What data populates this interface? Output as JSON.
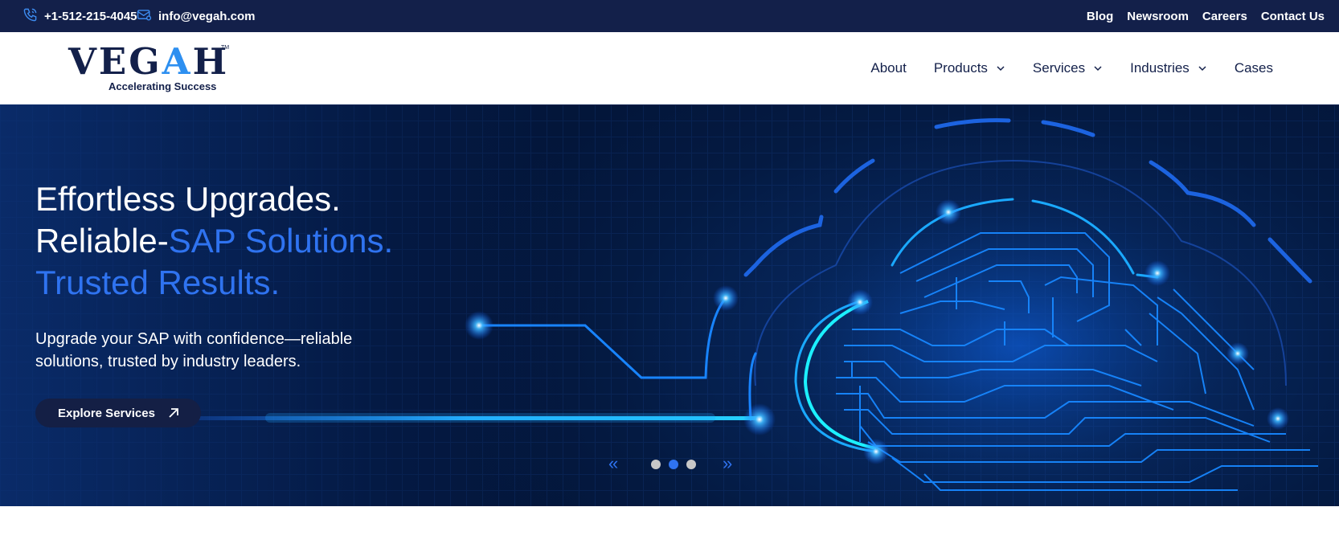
{
  "topbar": {
    "phone": "+1-512-215-4045",
    "email": "info@vegah.com",
    "links": [
      "Blog",
      "Newsroom",
      "Careers",
      "Contact Us"
    ],
    "background": "#13204a"
  },
  "logo": {
    "word_start": "VEG",
    "word_a": "A",
    "word_end": "H",
    "tagline": "Accelerating Success",
    "trademark": "TM"
  },
  "nav": {
    "items": [
      {
        "label": "About"
      },
      {
        "label": "Products"
      },
      {
        "label": "Services"
      },
      {
        "label": "Industries"
      },
      {
        "label": "Cases"
      }
    ]
  },
  "hero": {
    "line1": "Effortless Upgrades.",
    "line2_prefix": "Reliable-",
    "line2_highlight": "SAP Solutions.",
    "line3": "Trusted Results.",
    "subtext": "Upgrade your SAP with confidence—reliable solutions, trusted by industry leaders.",
    "cta_label": "Explore Services",
    "accent_color": "#2f73f0",
    "slides_total": 3,
    "active_slide": 2,
    "prev_glyph": "«",
    "next_glyph": "»"
  }
}
